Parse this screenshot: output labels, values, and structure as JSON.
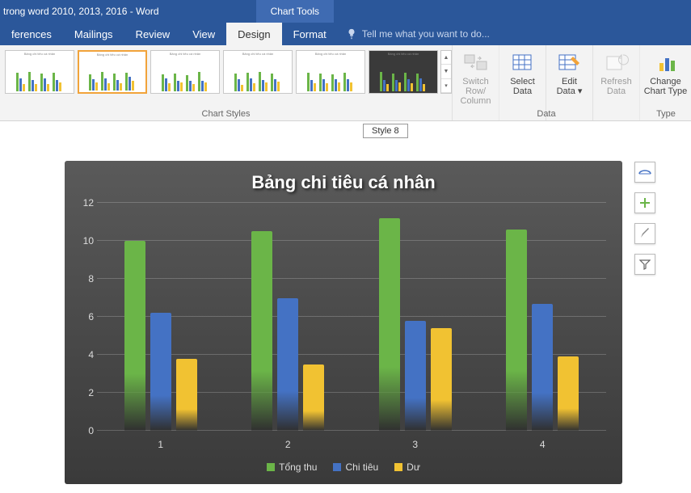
{
  "titlebar": {
    "document_fragment": " trong word 2010, 2013, 2016 - Word",
    "tool_tab": "Chart Tools"
  },
  "tabs": {
    "references": "ferences",
    "mailings": "Mailings",
    "review": "Review",
    "view": "View",
    "design": "Design",
    "format": "Format",
    "tellme": "Tell me what you want to do..."
  },
  "ribbon": {
    "styles_label": "Chart Styles",
    "data_label": "Data",
    "type_label": "Type",
    "switch_row": "Switch Row/\nColumn",
    "select_data": "Select\nData",
    "edit_data": "Edit\nData ▾",
    "refresh_data": "Refresh\nData",
    "change_type": "Change\nChart Type"
  },
  "tooltip": "Style 8",
  "colors": {
    "s1": "#6bb548",
    "s2": "#4472c4",
    "s3": "#f1c232"
  },
  "chart_data": {
    "type": "bar",
    "title": "Bảng chi tiêu cá nhân",
    "categories": [
      "1",
      "2",
      "3",
      "4"
    ],
    "series": [
      {
        "name": "Tổng thu",
        "color": "#6bb548",
        "values": [
          10.0,
          10.5,
          11.2,
          10.6
        ]
      },
      {
        "name": "Chi tiêu",
        "color": "#4472c4",
        "values": [
          6.2,
          7.0,
          5.8,
          6.7
        ]
      },
      {
        "name": "Dư",
        "color": "#f1c232",
        "values": [
          3.8,
          3.5,
          5.4,
          3.9
        ]
      }
    ],
    "ylim": [
      0,
      12
    ],
    "yticks": [
      0,
      2,
      4,
      6,
      8,
      10,
      12
    ],
    "xlabel": "",
    "ylabel": ""
  }
}
